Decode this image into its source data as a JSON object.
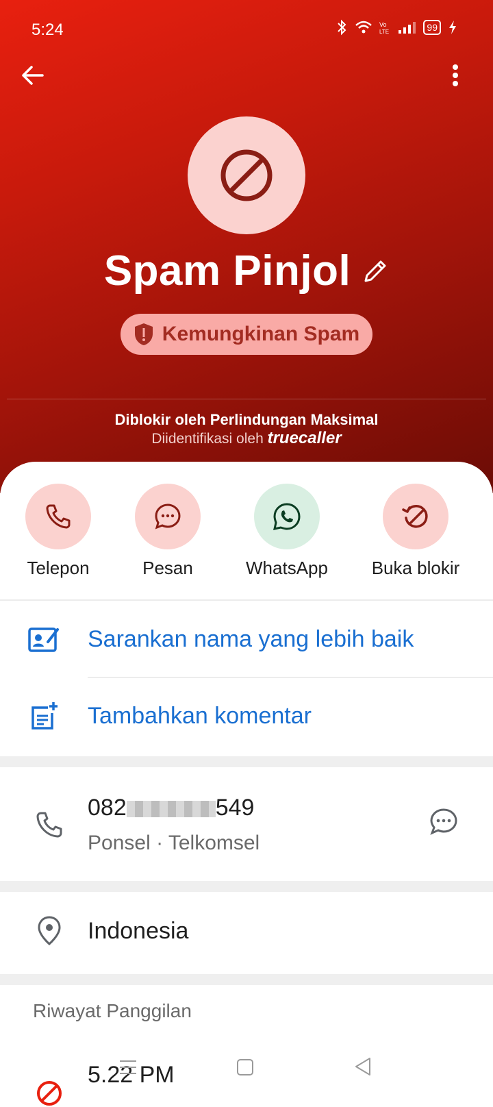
{
  "status_bar": {
    "time": "5:24",
    "battery": "99"
  },
  "contact": {
    "name": "Spam Pinjol",
    "badge": "Kemungkinan Spam",
    "blocked_by": "Diblokir oleh Perlindungan Maksimal",
    "identified_by": "Diidentifikasi oleh",
    "brand": "truecaller"
  },
  "actions": [
    {
      "label": "Telepon",
      "icon": "phone-icon",
      "bg": "#fbd2cf"
    },
    {
      "label": "Pesan",
      "icon": "message-icon",
      "bg": "#fbd2cf"
    },
    {
      "label": "WhatsApp",
      "icon": "whatsapp-icon",
      "bg": "#d9efe2"
    },
    {
      "label": "Buka blokir",
      "icon": "unblock-icon",
      "bg": "#fbd2cf"
    }
  ],
  "links": {
    "suggest_name": "Sarankan nama yang lebih baik",
    "add_comment": "Tambahkan komentar"
  },
  "phone": {
    "number_start": "082",
    "number_end": "549",
    "detail": "Ponsel · Telkomsel"
  },
  "location": "Indonesia",
  "history": {
    "title": "Riwayat Panggilan",
    "first_time": "5.22 PM"
  },
  "colors": {
    "accent_red": "#c81a0c",
    "link_blue": "#1a6fd1",
    "spam_badge": "#f9aaa6"
  }
}
